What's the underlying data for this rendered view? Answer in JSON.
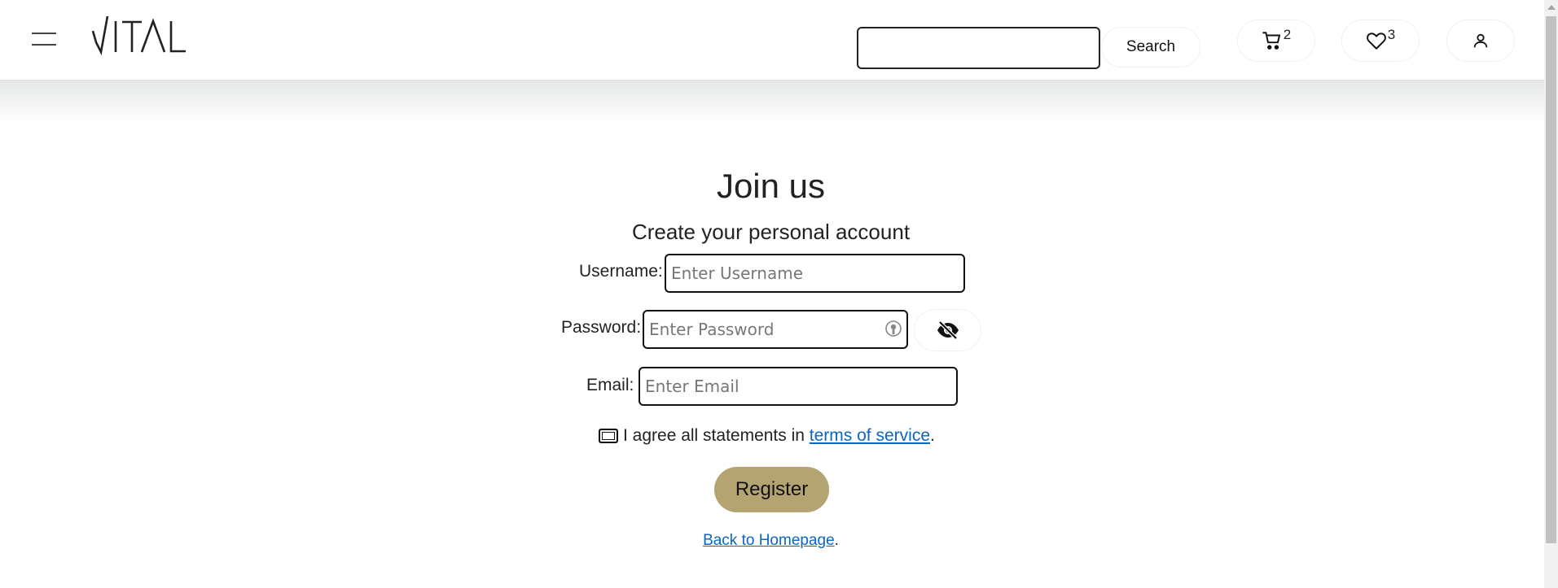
{
  "header": {
    "search": {
      "value": "",
      "placeholder": "",
      "button_label": "Search"
    },
    "cart": {
      "count": "2",
      "icon": "cart-icon"
    },
    "wishlist": {
      "count": "3",
      "icon": "heart-icon"
    },
    "account": {
      "icon": "user-icon"
    },
    "logo": {
      "text": "VITAL"
    }
  },
  "form": {
    "title": "Join us",
    "subtitle": "Create your personal account",
    "username": {
      "label": "Username:",
      "placeholder": "Enter Username",
      "value": ""
    },
    "password": {
      "label": "Password:",
      "placeholder": "Enter Password",
      "value": ""
    },
    "email": {
      "label": "Email:",
      "placeholder": "Enter Email",
      "value": ""
    },
    "agree": {
      "text": "I agree all statements in ",
      "link": "terms of service",
      "suffix": "."
    },
    "register_label": "Register",
    "back": {
      "link": "Back to Homepage",
      "suffix": "."
    }
  },
  "colors": {
    "accent": "#b4a472",
    "link": "#0a66c2",
    "border": "#111111"
  }
}
